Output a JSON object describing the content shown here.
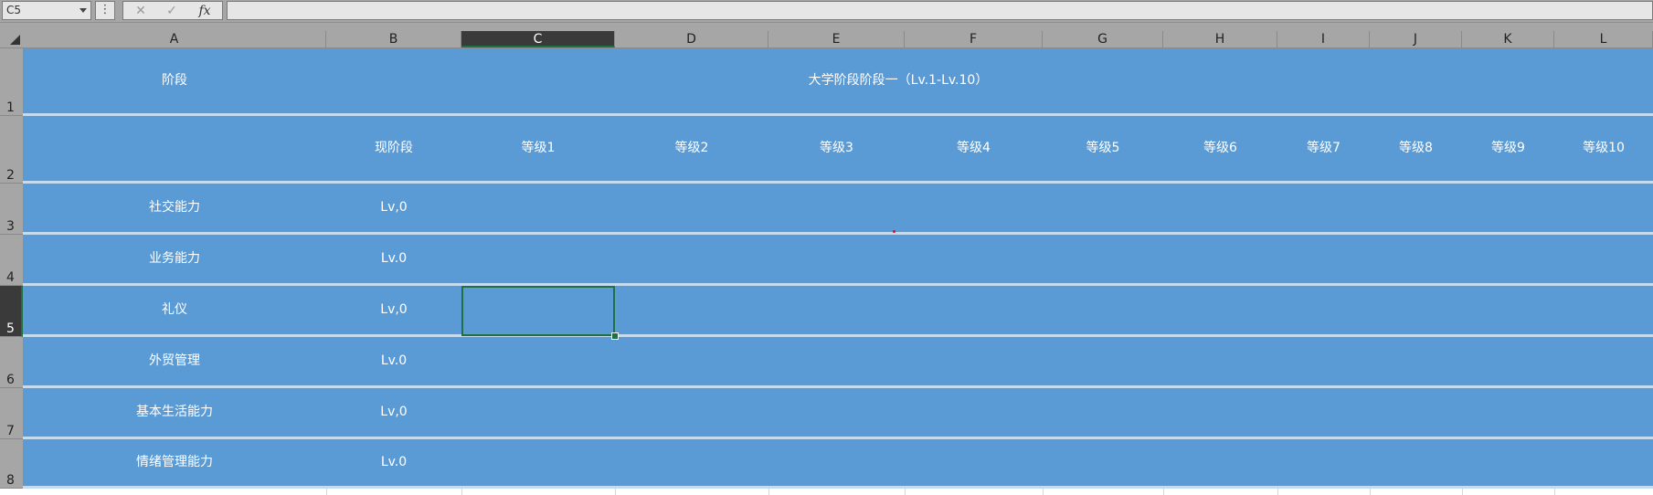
{
  "formula_bar": {
    "name_box": "C5",
    "separator": "⋮",
    "cancel_icon": "✕",
    "confirm_icon": "✓",
    "fx_label": "fx",
    "formula": ""
  },
  "columns": [
    "A",
    "B",
    "C",
    "D",
    "E",
    "F",
    "G",
    "H",
    "I",
    "J",
    "K",
    "L"
  ],
  "active_column": "C",
  "rows": [
    "1",
    "2",
    "3",
    "4",
    "5",
    "6",
    "7",
    "8"
  ],
  "active_row": "5",
  "sheet": {
    "header_row": {
      "a": "阶段",
      "title": "大学阶段阶段一（Lv.1-Lv.10）"
    },
    "level_row": {
      "b": "现阶段",
      "levels": [
        "等级1",
        "等级2",
        "等级3",
        "等级4",
        "等级5",
        "等级6",
        "等级7",
        "等级8",
        "等级9",
        "等级10"
      ]
    },
    "skills": [
      {
        "name": "社交能力",
        "current": "Lv,0"
      },
      {
        "name": "业务能力",
        "current": "Lv.0"
      },
      {
        "name": "礼仪",
        "current": "Lv,0"
      },
      {
        "name": "外贸管理",
        "current": "Lv.0"
      },
      {
        "name": "基本生活能力",
        "current": "Lv,0"
      },
      {
        "name": "情绪管理能力",
        "current": "Lv.0"
      }
    ]
  },
  "colors": {
    "cell_fill": "#5b9bd5",
    "row_separator": "#c5dcf0",
    "selection": "#1e7145",
    "header_bg": "#a6a6a6"
  }
}
